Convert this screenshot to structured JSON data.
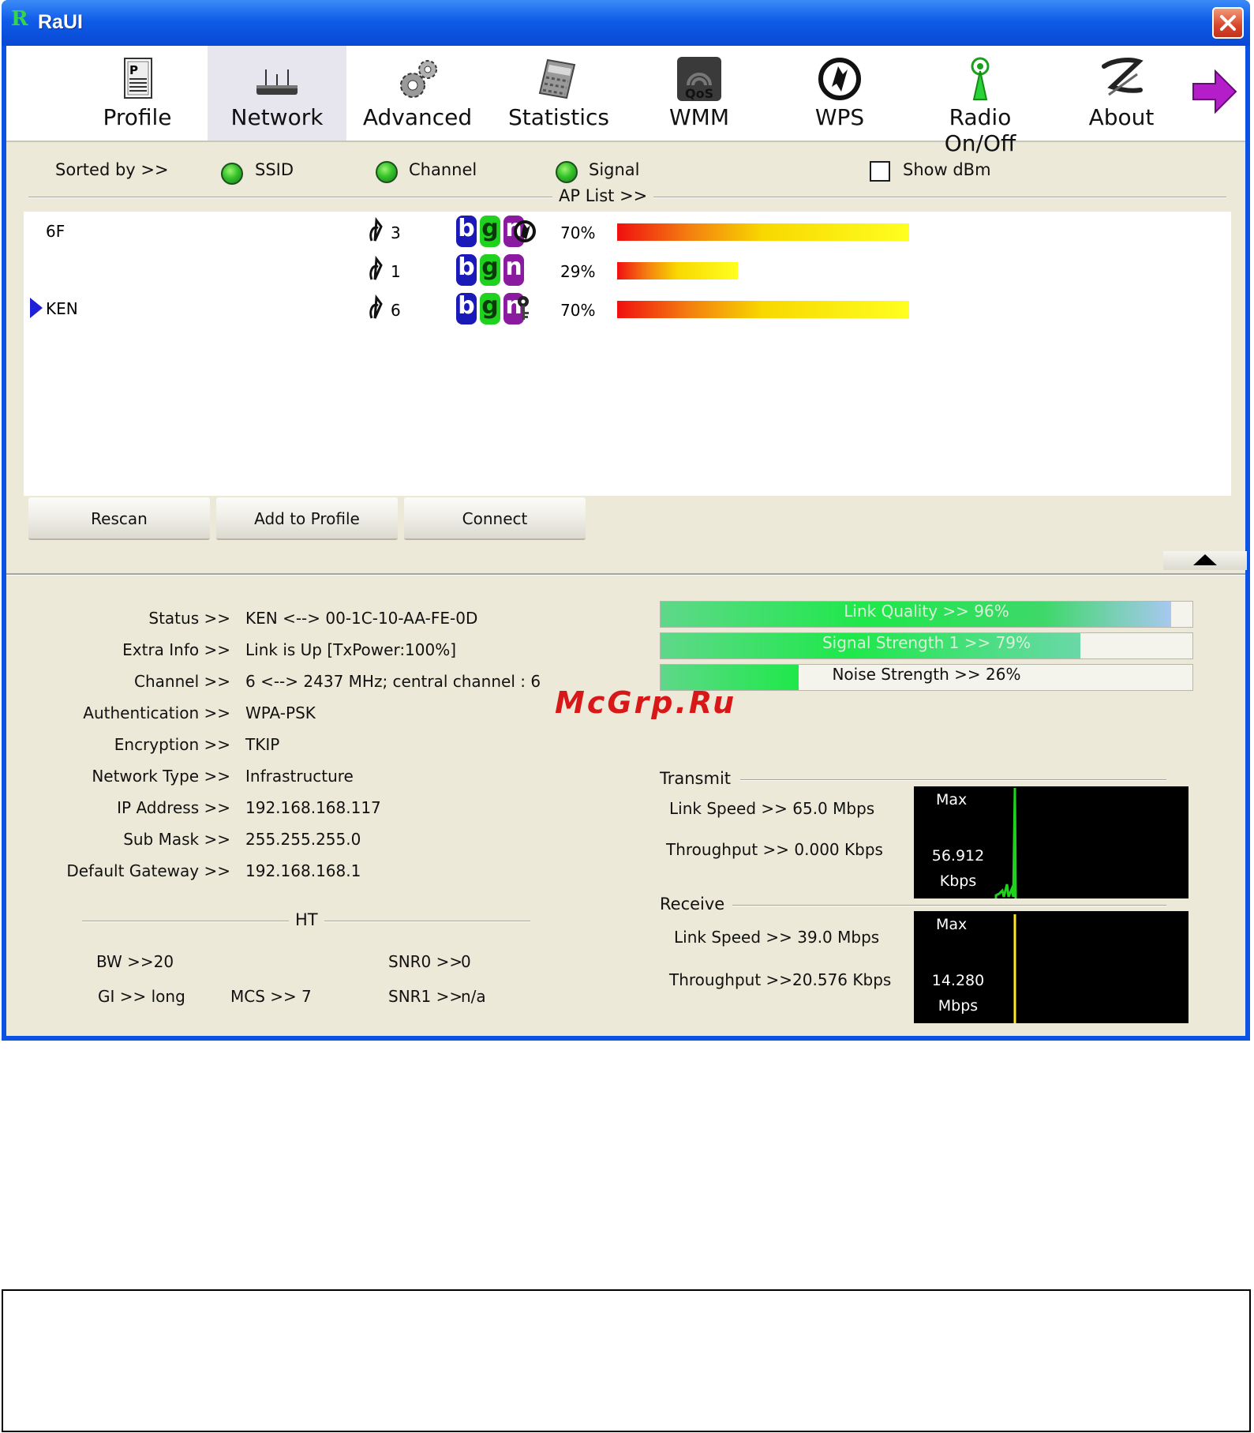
{
  "window": {
    "title": "RaUI",
    "logo": "R",
    "close_icon": "close-icon"
  },
  "toolbar": {
    "items": [
      {
        "label": "Profile",
        "icon": "profile-icon"
      },
      {
        "label": "Network",
        "icon": "network-icon",
        "active": true
      },
      {
        "label": "Advanced",
        "icon": "advanced-icon"
      },
      {
        "label": "Statistics",
        "icon": "statistics-icon"
      },
      {
        "label": "WMM",
        "icon": "wmm-qos-icon"
      },
      {
        "label": "WPS",
        "icon": "wps-icon"
      },
      {
        "label": "Radio On/Off",
        "icon": "radio-icon"
      },
      {
        "label": "About",
        "icon": "about-icon"
      }
    ],
    "next_icon": "next-arrow-icon"
  },
  "sort": {
    "label": "Sorted by >>",
    "options": [
      "SSID",
      "Channel",
      "Signal"
    ],
    "show_dbm": "Show dBm",
    "show_dbm_checked": false
  },
  "ap_list": {
    "title": "AP List >>",
    "rows": [
      {
        "ssid": "6F",
        "channel": "3",
        "modes": [
          "b",
          "g",
          "n"
        ],
        "extra": "wps-icon",
        "signal": "70%",
        "signal_value": 0.7,
        "selected": false
      },
      {
        "ssid": "",
        "channel": "1",
        "modes": [
          "b",
          "g",
          "n"
        ],
        "extra": "",
        "signal": "29%",
        "signal_value": 0.29,
        "selected": false
      },
      {
        "ssid": "KEN",
        "channel": "6",
        "modes": [
          "b",
          "g",
          "n"
        ],
        "extra": "key-icon",
        "signal": "70%",
        "signal_value": 0.7,
        "selected": true
      }
    ]
  },
  "buttons": {
    "rescan": "Rescan",
    "add_to_profile": "Add to Profile",
    "connect": "Connect"
  },
  "status": {
    "rows": [
      {
        "label": "Status >>",
        "value": "KEN <--> 00-1C-10-AA-FE-0D"
      },
      {
        "label": "Extra Info >>",
        "value": "Link is Up [TxPower:100%]"
      },
      {
        "label": "Channel >>",
        "value": "6 <--> 2437 MHz; central channel : 6"
      },
      {
        "label": "Authentication >>",
        "value": "WPA-PSK"
      },
      {
        "label": "Encryption >>",
        "value": "TKIP"
      },
      {
        "label": "Network Type >>",
        "value": "Infrastructure"
      },
      {
        "label": "IP Address >>",
        "value": "192.168.168.117"
      },
      {
        "label": "Sub Mask >>",
        "value": "255.255.255.0"
      },
      {
        "label": "Default Gateway >>",
        "value": "192.168.168.1"
      }
    ]
  },
  "gauges": [
    {
      "label": "Link Quality >> 96%",
      "value": 0.96
    },
    {
      "label": "Signal Strength 1 >> 79%",
      "value": 0.79
    },
    {
      "label": "Noise Strength >> 26%",
      "value": 0.26
    }
  ],
  "watermark": "McGrp.Ru",
  "ht": {
    "title": "HT",
    "bw": "BW >>20",
    "gi": "GI >> long",
    "mcs": "MCS >>",
    "mcs_value": "7",
    "snr0": "SNR0 >>",
    "snr0_value": "0",
    "snr1": "SNR1 >>",
    "snr1_value": "n/a"
  },
  "transmit": {
    "title": "Transmit",
    "link_speed": "Link Speed >>  65.0 Mbps",
    "throughput": "Throughput >> 0.000 Kbps",
    "graph_max": "Max",
    "graph_value": "56.912",
    "graph_unit": "Kbps",
    "color": "#1ed21e"
  },
  "receive": {
    "title": "Receive",
    "link_speed": "Link Speed >> 39.0 Mbps",
    "throughput": "Throughput >>20.576 Kbps",
    "graph_max": "Max",
    "graph_value": "14.280",
    "graph_unit": "Mbps",
    "color": "#ffe81e"
  }
}
